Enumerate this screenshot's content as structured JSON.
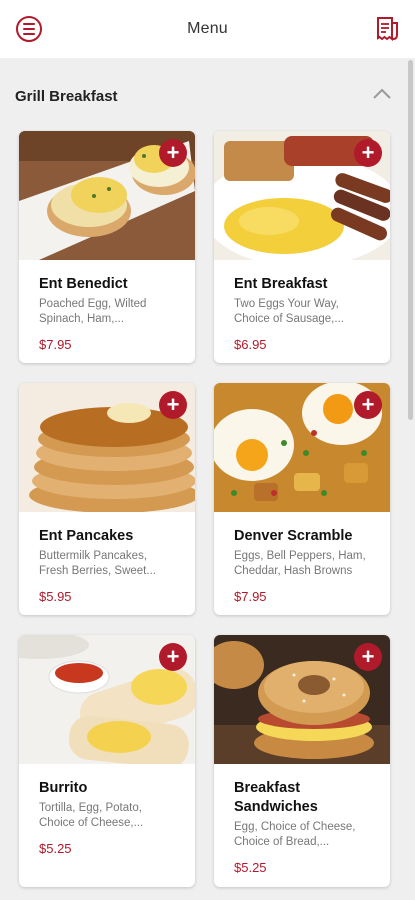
{
  "header": {
    "title": "Menu",
    "menu_icon": "hamburger-menu-icon",
    "cart_icon": "receipt-icon"
  },
  "section": {
    "name": "Grill Breakfast",
    "collapse_icon": "chevron-up-icon"
  },
  "colors": {
    "accent": "#b01a2a",
    "background": "#efefef"
  },
  "items": [
    {
      "name": "Ent Benedict",
      "desc_line1": "Poached Egg, Wilted",
      "desc_line2": "Spinach, Ham,...",
      "price": "$7.95"
    },
    {
      "name": "Ent Breakfast",
      "desc_line1": "Two Eggs Your Way,",
      "desc_line2": "Choice of Sausage,...",
      "price": "$6.95"
    },
    {
      "name": "Ent Pancakes",
      "desc_line1": "Buttermilk Pancakes,",
      "desc_line2": "Fresh Berries, Sweet...",
      "price": "$5.95"
    },
    {
      "name": "Denver Scramble",
      "desc_line1": "Eggs, Bell Peppers, Ham,",
      "desc_line2": "Cheddar, Hash Browns",
      "price": "$7.95"
    },
    {
      "name": "Burrito",
      "desc_line1": "Tortilla, Egg, Potato,",
      "desc_line2": "Choice of Cheese,...",
      "price": "$5.25"
    },
    {
      "name_line1": "Breakfast",
      "name_line2": "Sandwiches",
      "desc_line1": "Egg, Choice of Cheese,",
      "desc_line2": "Choice of Bread,...",
      "price": "$5.25"
    }
  ]
}
